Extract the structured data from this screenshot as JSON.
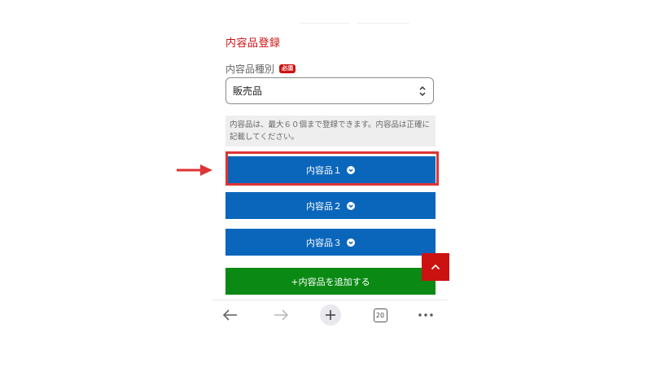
{
  "form": {
    "section_title": "内容品登録",
    "field_label": "内容品種別",
    "required_badge": "必須",
    "select_value": "販売品",
    "notice": "内容品は、最大６０個まで登録できます。内容品は正確に記載してください。"
  },
  "items": [
    {
      "label": "内容品１"
    },
    {
      "label": "内容品２"
    },
    {
      "label": "内容品３"
    }
  ],
  "add_button": "+内容品を追加する",
  "toolbar": {
    "tab_count": "20"
  },
  "colors": {
    "accent_red": "#cc1111",
    "item_blue": "#0a66bb",
    "add_green": "#0a8a14",
    "highlight_red": "#e03333"
  }
}
